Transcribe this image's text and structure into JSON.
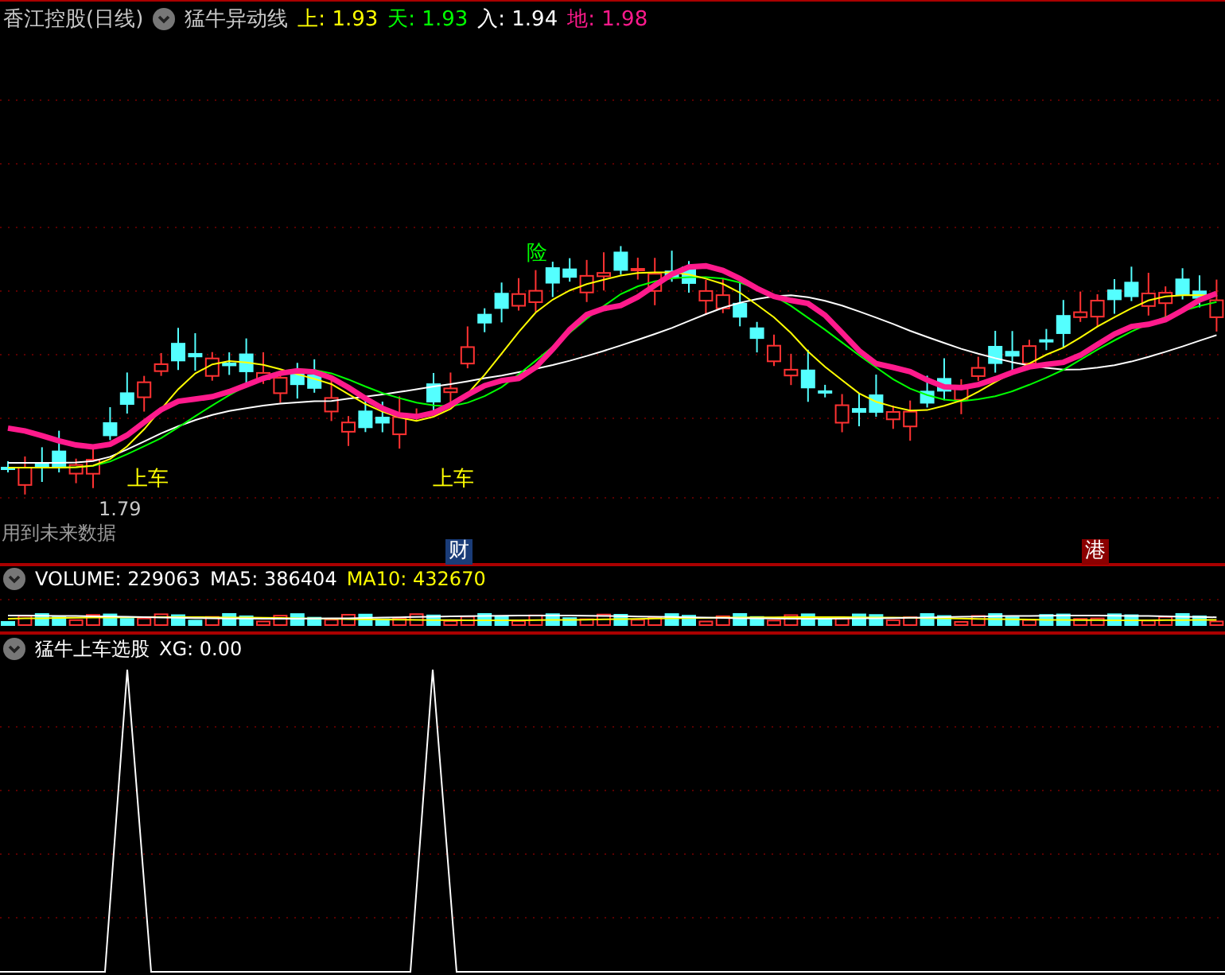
{
  "header": {
    "title": "香江控股(日线)",
    "indicator": "猛牛异动线",
    "values": [
      {
        "label": "上:",
        "value": "1.93",
        "color": "#ffff00"
      },
      {
        "label": "天:",
        "value": "1.93",
        "color": "#00ff00"
      },
      {
        "label": "入:",
        "value": "1.94",
        "color": "#ffffff"
      },
      {
        "label": "地:",
        "value": "1.98",
        "color": "#ff1a8c"
      }
    ]
  },
  "main_chart": {
    "signals": [
      "险",
      "上车",
      "上车"
    ],
    "low_price": "1.79",
    "note": "用到未来数据",
    "events": [
      {
        "text": "财",
        "color": "#1a3c78"
      },
      {
        "text": "港",
        "color": "#8b0000"
      }
    ]
  },
  "volume_panel": {
    "values": [
      {
        "label": "VOLUME:",
        "value": "229063",
        "color": "#ffffff"
      },
      {
        "label": "MA5:",
        "value": "386404",
        "color": "#ffffff"
      },
      {
        "label": "MA10:",
        "value": "432670",
        "color": "#ffff00"
      }
    ]
  },
  "signal_panel": {
    "title": "猛牛上车选股",
    "values": [
      {
        "label": "XG:",
        "value": "0.00",
        "color": "#ffffff"
      }
    ]
  }
}
